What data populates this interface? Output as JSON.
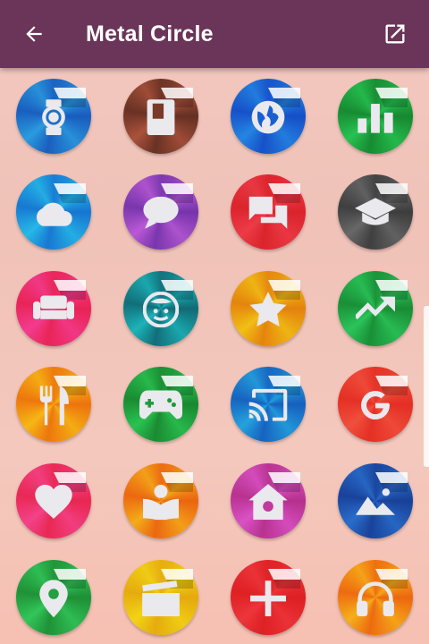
{
  "appbar": {
    "title": "Metal Circle",
    "back_icon": "arrow-left-icon",
    "open_icon": "open-in-new-icon",
    "background": "#6a3558"
  },
  "icons": [
    {
      "name": "watch",
      "color": "#1e6fc8"
    },
    {
      "name": "book",
      "color": "#7a3a2a"
    },
    {
      "name": "globe",
      "color": "#1a5fd0"
    },
    {
      "name": "bar-chart",
      "color": "#1b9a3a"
    },
    {
      "name": "cloud",
      "color": "#1b8ad8"
    },
    {
      "name": "chat-bubble",
      "color": "#8a3fb8"
    },
    {
      "name": "chat-boxes",
      "color": "#e02a33"
    },
    {
      "name": "graduation-cap",
      "color": "#4a4a4a"
    },
    {
      "name": "sofa",
      "color": "#ec2a66"
    },
    {
      "name": "face",
      "color": "#14818a"
    },
    {
      "name": "star",
      "color": "#e8940f"
    },
    {
      "name": "trending-up",
      "color": "#1e9e40"
    },
    {
      "name": "fork-knife",
      "color": "#f0880f"
    },
    {
      "name": "gamepad",
      "color": "#1e9a3a"
    },
    {
      "name": "cast",
      "color": "#1a74c8"
    },
    {
      "name": "google",
      "color": "#e8382b"
    },
    {
      "name": "heart",
      "color": "#ec2f62"
    },
    {
      "name": "reader",
      "color": "#ee7a12"
    },
    {
      "name": "home",
      "color": "#c13a9e"
    },
    {
      "name": "image",
      "color": "#1d4ea8"
    },
    {
      "name": "map-pin",
      "color": "#24a040"
    },
    {
      "name": "clapperboard",
      "color": "#e9b60f"
    },
    {
      "name": "plus",
      "color": "#e2262a"
    },
    {
      "name": "headphones",
      "color": "#f07d12"
    }
  ]
}
